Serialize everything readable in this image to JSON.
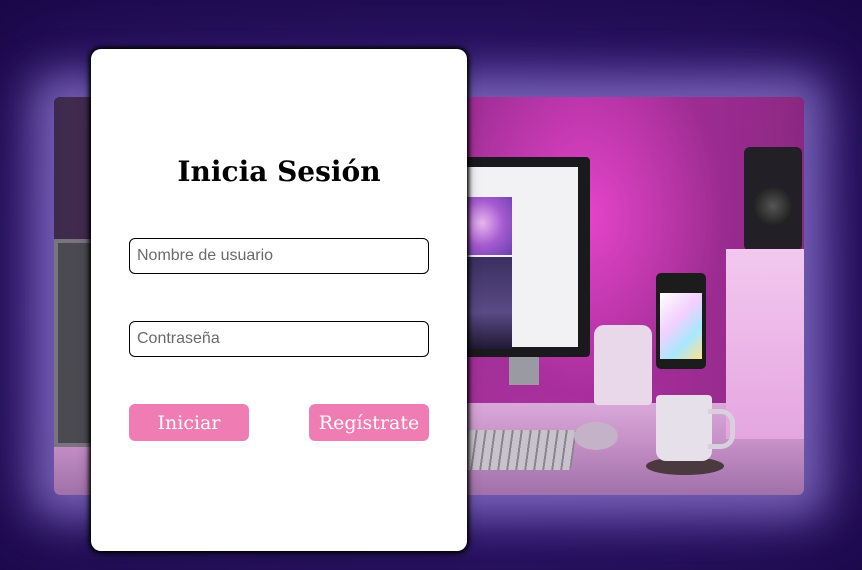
{
  "login": {
    "title": "Inicia Sesión",
    "username_placeholder": "Nombre de usuario",
    "password_placeholder": "Contraseña",
    "login_button": "Iniciar",
    "register_button": "Regístrate"
  },
  "colors": {
    "button": "#f07cb4",
    "page_background": "#24105a",
    "card_background": "#ffffff"
  }
}
